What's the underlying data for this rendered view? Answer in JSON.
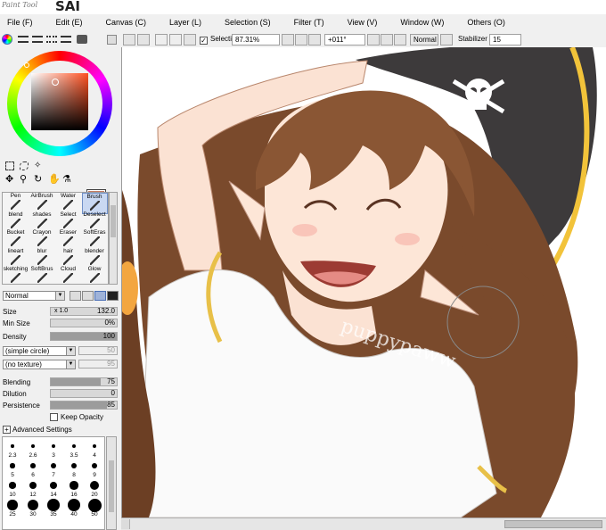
{
  "app": {
    "logo_small": "Paint Tool",
    "logo_big": "SAI",
    "accent": "#6f8fc7"
  },
  "menu": [
    "File (F)",
    "Edit (E)",
    "Canvas (C)",
    "Layer (L)",
    "Selection (S)",
    "Filter (T)",
    "View (V)",
    "Window (W)",
    "Others (O)"
  ],
  "toolbar": {
    "selection_label": "Selection",
    "selection_checked": true,
    "zoom": "87.31%",
    "rotation": "+011°",
    "blend_mode": "Normal",
    "stabilizer_label": "Stabilizer",
    "stabilizer_value": "15"
  },
  "color": {
    "main": "#c87c62",
    "secondary": "#000000"
  },
  "tools": [
    {
      "label": "Pen",
      "icon": "pen-icon",
      "active": false
    },
    {
      "label": "AirBrush",
      "icon": "airbrush-icon",
      "active": false
    },
    {
      "label": "Water",
      "icon": "water-icon",
      "active": false
    },
    {
      "label": "Brush",
      "icon": "brush-icon",
      "active": true
    },
    {
      "label": "blend",
      "icon": "blend-icon",
      "active": false
    },
    {
      "label": "shades",
      "icon": "shades-icon",
      "active": false
    },
    {
      "label": "Select",
      "icon": "select-icon",
      "active": false
    },
    {
      "label": "Deselect",
      "icon": "deselect-icon",
      "active": false
    },
    {
      "label": "Bucket",
      "icon": "bucket-icon",
      "active": false
    },
    {
      "label": "Crayon",
      "icon": "crayon-icon",
      "active": false
    },
    {
      "label": "Eraser",
      "icon": "eraser-icon",
      "active": false
    },
    {
      "label": "SoftEras",
      "icon": "softeraser-icon",
      "active": false
    },
    {
      "label": "lineart",
      "icon": "lineart-icon",
      "active": false
    },
    {
      "label": "blur",
      "icon": "blur-icon",
      "active": false
    },
    {
      "label": "hair",
      "icon": "hair-icon",
      "active": false
    },
    {
      "label": "blender",
      "icon": "blender-icon",
      "active": false
    },
    {
      "label": "sketching",
      "icon": "sketching-icon",
      "active": false
    },
    {
      "label": "SoftBrus",
      "icon": "softbrush-icon",
      "active": false
    },
    {
      "label": "Cloud",
      "icon": "cloud-icon",
      "active": false
    },
    {
      "label": "Glow",
      "icon": "glow-icon",
      "active": false
    }
  ],
  "brush": {
    "blend_mode": "Normal",
    "size_label": "Size",
    "size_multiplier": "x 1.0",
    "size_value": "132.0",
    "min_size_label": "Min Size",
    "min_size_value": "0%",
    "min_size_fraction": 0.0,
    "density_label": "Density",
    "density_value": "100",
    "density_fraction": 1.0,
    "shape": "(simple circle)",
    "shape_value": "50",
    "texture": "(no texture)",
    "texture_value": "95",
    "blending_label": "Blending",
    "blending_value": "75",
    "blending_fraction": 0.75,
    "dilution_label": "Dilution",
    "dilution_value": "0",
    "dilution_fraction": 0.0,
    "persistence_label": "Persistence",
    "persistence_value": "85",
    "persistence_fraction": 0.85,
    "keep_opacity_label": "Keep Opacity",
    "advanced_label": "Advanced Settings"
  },
  "brush_sizes": [
    "2.3",
    "2.6",
    "3",
    "3.5",
    "4",
    "5",
    "6",
    "7",
    "8",
    "9",
    "10",
    "12",
    "14",
    "16",
    "20",
    "25",
    "30",
    "35",
    "40",
    "50"
  ],
  "canvas": {
    "watermark": "puppypaww"
  }
}
